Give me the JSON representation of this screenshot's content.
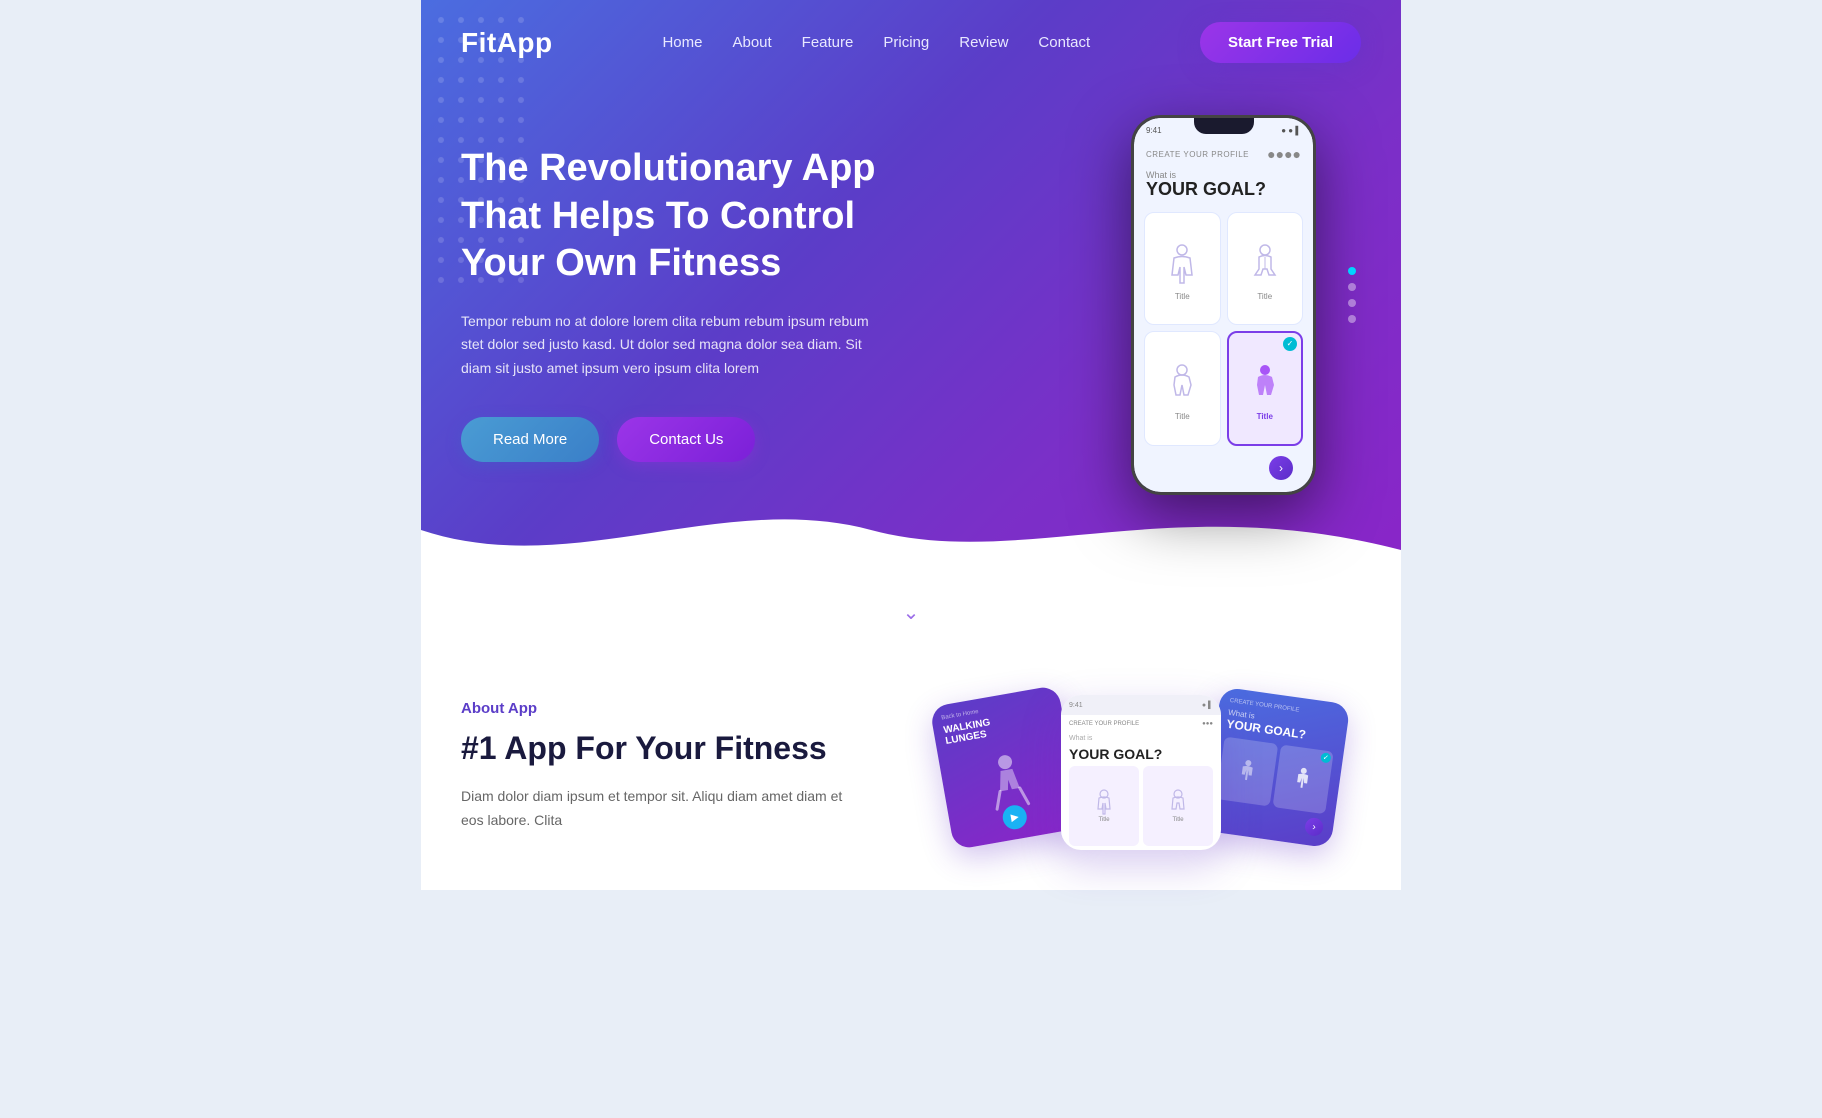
{
  "brand": {
    "logo": "FitApp"
  },
  "nav": {
    "links": [
      {
        "label": "Home",
        "id": "home"
      },
      {
        "label": "About",
        "id": "about"
      },
      {
        "label": "Feature",
        "id": "feature"
      },
      {
        "label": "Pricing",
        "id": "pricing"
      },
      {
        "label": "Review",
        "id": "review"
      },
      {
        "label": "Contact",
        "id": "contact"
      }
    ],
    "cta_label": "Start Free Trial"
  },
  "hero": {
    "title": "The Revolutionary App That Helps To Control Your Own Fitness",
    "description": "Tempor rebum no at dolore lorem clita rebum rebum ipsum rebum stet dolor sed justo kasd. Ut dolor sed magna dolor sea diam. Sit diam sit justo amet ipsum vero ipsum clita lorem",
    "btn_read_more": "Read More",
    "btn_contact": "Contact Us",
    "phone": {
      "header_label": "CREATE YOUR PROFILE",
      "what_is": "What is",
      "goal_title": "YOUR GOAL?",
      "grid_items": [
        {
          "label": "Title",
          "selected": false
        },
        {
          "label": "Title",
          "selected": false
        },
        {
          "label": "Title",
          "selected": false
        },
        {
          "label": "Title",
          "selected": true
        }
      ]
    }
  },
  "scroll_down_icon": "chevron-down",
  "about": {
    "label": "About App",
    "title": "#1 App For Your Fitness",
    "description": "Diam dolor diam ipsum et tempor sit. Aliqu diam amet diam et eos labore. Clita",
    "cards": [
      {
        "id": "card1",
        "label": "Back to Home",
        "title": "WALKING LUNGES"
      },
      {
        "id": "card2",
        "label": "CREATE YOUR PROFILE",
        "title": "YOUR GOAL?"
      },
      {
        "id": "card3",
        "label": "CREATE YOUR PROFILE",
        "title": "YOUR GOAL?"
      }
    ]
  },
  "colors": {
    "hero_gradient_start": "#4b6de0",
    "hero_gradient_mid": "#6b3dc8",
    "hero_gradient_end": "#8a25c8",
    "accent_cyan": "#00d4ff",
    "accent_purple": "#7b3de8",
    "about_label_color": "#5b3dc8"
  }
}
